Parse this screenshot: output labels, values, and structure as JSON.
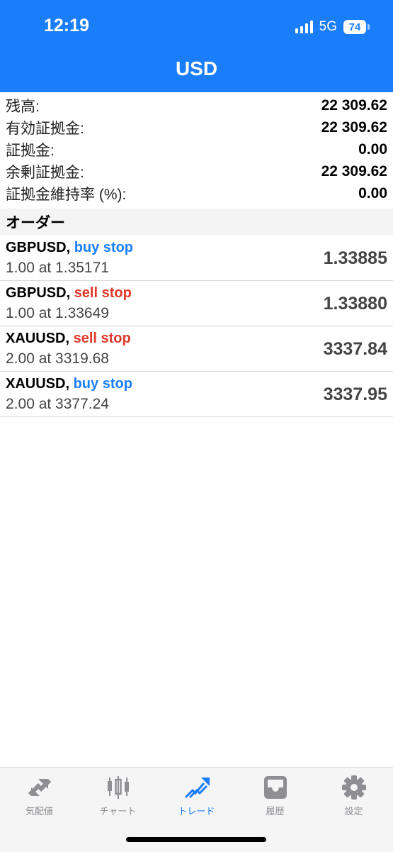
{
  "status_bar": {
    "time": "12:19",
    "network": "5G",
    "battery": "74"
  },
  "header": {
    "title": "USD"
  },
  "summary": [
    {
      "label": "残高:",
      "value": "22 309.62"
    },
    {
      "label": "有効証拠金:",
      "value": "22 309.62"
    },
    {
      "label": "証拠金:",
      "value": "0.00"
    },
    {
      "label": "余剰証拠金:",
      "value": "22 309.62"
    },
    {
      "label": "証拠金維持率 (%):",
      "value": "0.00"
    }
  ],
  "orders_section": {
    "title": "オーダー"
  },
  "orders": [
    {
      "symbol": "GBPUSD,",
      "type": "buy stop",
      "detail": "1.00 at 1.35171",
      "price": "1.33885"
    },
    {
      "symbol": "GBPUSD,",
      "type": "sell stop",
      "detail": "1.00 at 1.33649",
      "price": "1.33880"
    },
    {
      "symbol": "XAUUSD,",
      "type": "sell stop",
      "detail": "2.00 at 3319.68",
      "price": "3337.84"
    },
    {
      "symbol": "XAUUSD,",
      "type": "buy stop",
      "detail": "2.00 at 3377.24",
      "price": "3337.95"
    }
  ],
  "tabs": [
    {
      "label": "気配値",
      "icon": "quotes-arrows-icon"
    },
    {
      "label": "チャート",
      "icon": "candlestick-chart-icon"
    },
    {
      "label": "トレード",
      "icon": "trade-icon",
      "active": true
    },
    {
      "label": "履歴",
      "icon": "history-tray-icon"
    },
    {
      "label": "設定",
      "icon": "settings-gear-icon"
    }
  ],
  "colors": {
    "accent": "#1a7efb",
    "buy": "#1a7efb",
    "sell": "#e0382b"
  }
}
